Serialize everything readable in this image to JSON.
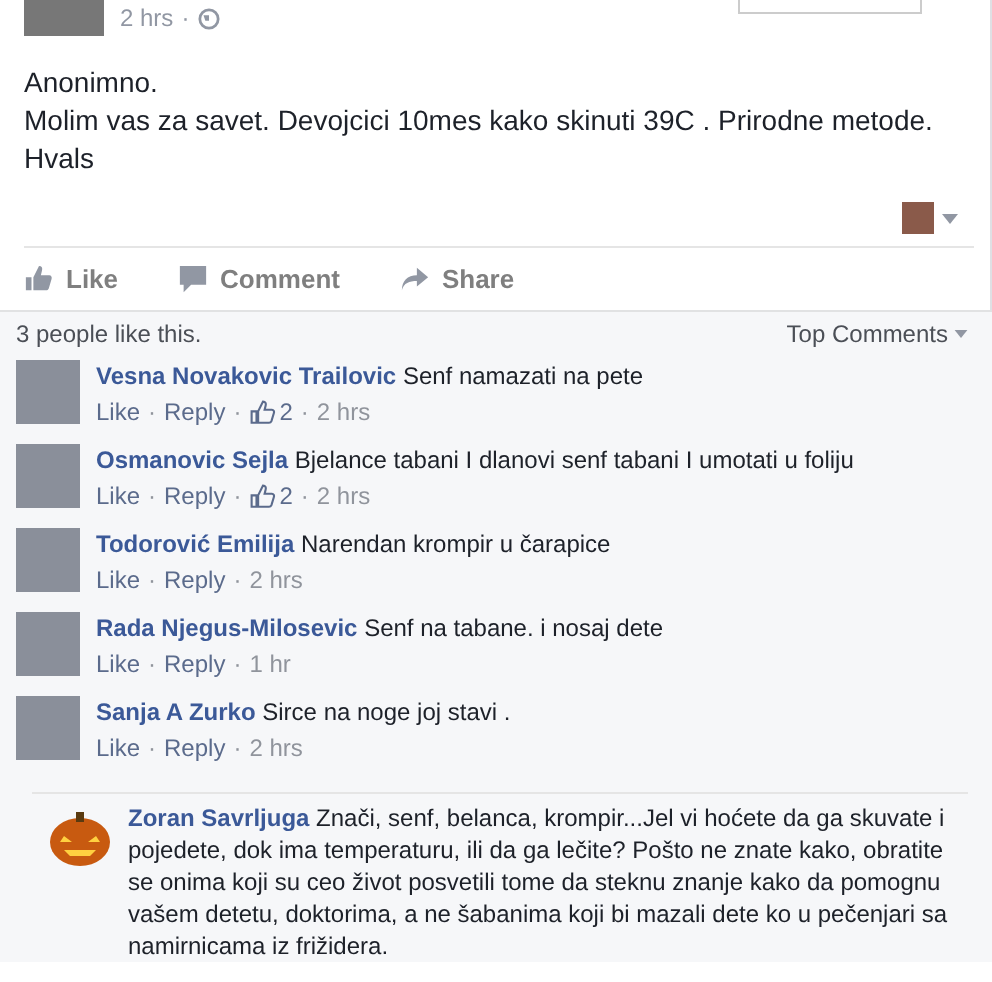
{
  "post": {
    "time": "2 hrs",
    "separator": "·",
    "lines": [
      "Anonimno.",
      "Molim vas za savet. Devojcici 10mes kako skinuti 39C . Prirodne metode.",
      "Hvals"
    ]
  },
  "actions": [
    {
      "kind": "like",
      "label": "Like"
    },
    {
      "kind": "comment",
      "label": "Comment"
    },
    {
      "kind": "share",
      "label": "Share"
    }
  ],
  "likes_summary": "3 people like this.",
  "sort": {
    "label": "Top Comments"
  },
  "separator": "·",
  "comments": [
    {
      "author": "Vesna Novakovic Trailovic",
      "text": "Senf namazati na pete",
      "like": "Like",
      "reply": "Reply",
      "likes": "2",
      "time": "2 hrs"
    },
    {
      "author": "Osmanovic Sejla",
      "text": "Bjelance tabani I dlanovi senf tabani I umotati u foliju",
      "like": "Like",
      "reply": "Reply",
      "likes": "2",
      "time": "2 hrs"
    },
    {
      "author": "Todorović Emilija",
      "text": "Narendan krompir u čarapice",
      "like": "Like",
      "reply": "Reply",
      "time": "2 hrs"
    },
    {
      "author": "Rada Njegus-Milosevic",
      "text": "Senf na tabane. i nosaj dete",
      "like": "Like",
      "reply": "Reply",
      "time": "1 hr"
    },
    {
      "author": "Sanja A Zurko",
      "text": "Sirce na noge joj stavi .",
      "like": "Like",
      "reply": "Reply",
      "time": "2 hrs"
    }
  ],
  "reply_comment": {
    "author": "Zoran Savrljuga",
    "text": "Znači, senf, belanca, krompir...Jel vi hoćete da ga skuvate i pojedete, dok ima temperaturu, ili da ga lečite? Pošto ne znate kako, obratite se onima koji su ceo život posvetili tome da steknu znanje kako da pomognu vašem detetu, doktorima, a ne šabanima koji bi mazali dete ko u pečenjari sa namirnicama iz frižidera."
  }
}
